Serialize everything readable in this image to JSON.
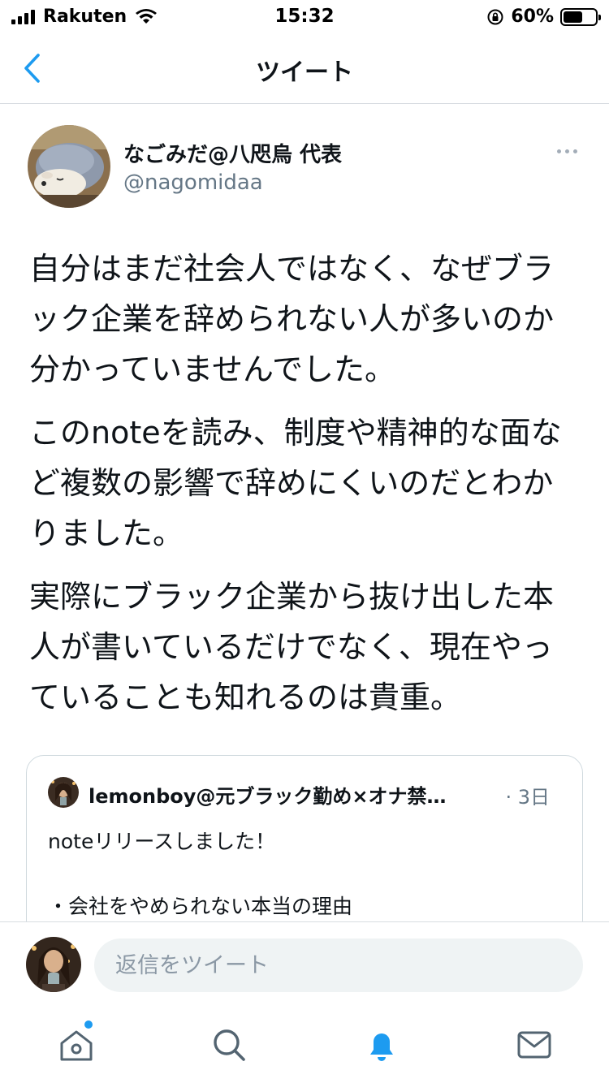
{
  "status_bar": {
    "carrier": "Rakuten",
    "time": "15:32",
    "battery_percent": "60%",
    "battery_level": 0.6
  },
  "header": {
    "title": "ツイート"
  },
  "tweet": {
    "display_name": "なごみだ@八咫烏 代表",
    "handle": "@nagomidaa",
    "paragraphs": [
      "自分はまだ社会人ではなく、なぜブラック企業を辞められない人が多いのか分かっていませんでした。",
      "このnoteを読み、制度や精神的な面など複数の影響で辞めにくいのだとわかりました。",
      "実際にブラック企業から抜け出した本人が書いているだけでなく、現在やっていることも知れるのは貴重。"
    ]
  },
  "quoted_tweet": {
    "author": "lemonboy@元ブラック勤め×オナ禁…",
    "time": "· 3日",
    "line1": "noteリリースしました！",
    "line2": "・会社をやめられない本当の理由"
  },
  "reply": {
    "placeholder": "返信をツイート"
  },
  "tab_bar": {
    "items": [
      "home-icon",
      "search-icon",
      "notifications-icon",
      "messages-icon"
    ],
    "active": "notifications-icon"
  },
  "colors": {
    "accent": "#1d9bf0",
    "text": "#0f1419",
    "secondary": "#657786"
  }
}
